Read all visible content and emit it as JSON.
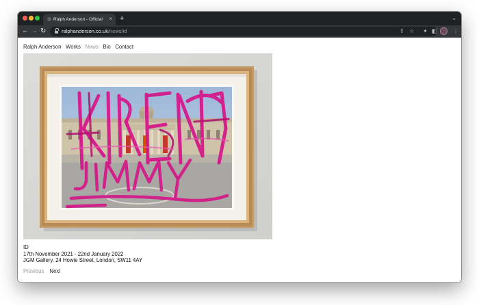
{
  "browser": {
    "tab_title": "Ralph Anderson - Official websi",
    "tab_close": "×",
    "new_tab": "+",
    "url_domain": "ralphanderson.co.uk",
    "url_path": "/news/id",
    "icons": [
      "back-icon",
      "forward-icon",
      "reload-icon",
      "lock-icon",
      "share-icon",
      "star-icon",
      "extensions-icon",
      "side-panel-icon",
      "profile-avatar",
      "menu-icon"
    ]
  },
  "site": {
    "nav": {
      "home": "Ralph Anderson",
      "works": "Works",
      "news": "News",
      "bio": "Bio",
      "contact": "Contact"
    },
    "exhibition": {
      "title": "ID",
      "dates": "17th November 2021 - 22nd January 2022",
      "venue": "JGM Gallery, 24 Howie Street, London, SW11 4AY"
    },
    "pager": {
      "previous": "Previous",
      "next": "Next"
    }
  },
  "artwork_painted_text": [
    "KIREN",
    "JIMMY"
  ],
  "colors": {
    "browser_dark": "#202124",
    "tab_active": "#35363a",
    "nav_active_muted": "#9b9b9b",
    "paint_magenta": "#d6148a"
  }
}
